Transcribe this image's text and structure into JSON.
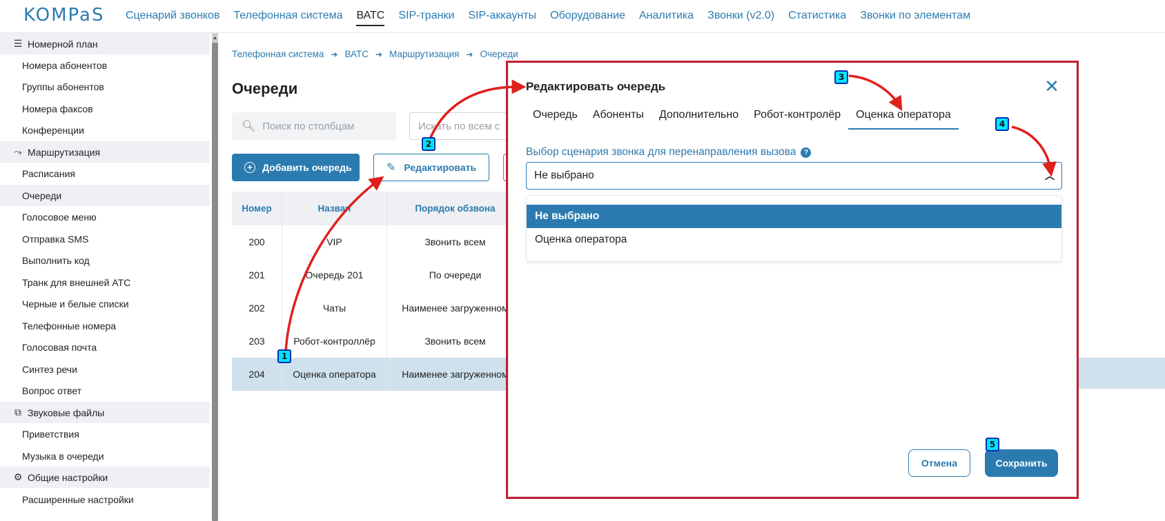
{
  "brand": {
    "logo_text": "KOMPaS",
    "accent": "#2b7bb0"
  },
  "nav": {
    "items": [
      "Сценарий звонков",
      "Телефонная система",
      "ВАТС",
      "SIP-транки",
      "SIP-аккаунты",
      "Оборудование",
      "Аналитика",
      "Звонки (v2.0)",
      "Статистика",
      "Звонки по элементам"
    ],
    "active_index": 2
  },
  "sidebar": {
    "groups": [
      {
        "icon": "list-icon",
        "label": "Номерной план",
        "items": [
          "Номера абонентов",
          "Группы абонентов",
          "Номера факсов",
          "Конференции"
        ]
      },
      {
        "icon": "routing-icon",
        "label": "Маршрутизация",
        "items": [
          "Расписания",
          "Очереди",
          "Голосовое меню",
          "Отправка SMS",
          "Выполнить код",
          "Транк для внешней АТС",
          "Черные и белые списки",
          "Телефонные номера",
          "Голосовая почта",
          "Синтез речи",
          "Вопрос ответ"
        ]
      },
      {
        "icon": "files-icon",
        "label": "Звуковые файлы",
        "items": [
          "Приветствия",
          "Музыка в очереди"
        ]
      },
      {
        "icon": "gear-icon",
        "label": "Общие настройки",
        "items": [
          "Расширенные настройки"
        ]
      }
    ],
    "selected_item": "Очереди"
  },
  "breadcrumb": [
    "Телефонная система",
    "ВАТС",
    "Маршрутизация",
    "Очереди"
  ],
  "page": {
    "title": "Очереди",
    "search_placeholder": "Поиск по столбцам",
    "search_all_placeholder": "Искать по всем с",
    "add_button": "Добавить очередь",
    "edit_button": "Редактировать"
  },
  "table": {
    "headers": [
      "Номер",
      "Назван",
      "Порядок обзвона"
    ],
    "rows": [
      [
        "200",
        "VIP",
        "Звонить всем"
      ],
      [
        "201",
        "Очередь 201",
        "По очереди"
      ],
      [
        "202",
        "Чаты",
        "Наименее загруженном"
      ],
      [
        "203",
        "Робот-контроллёр",
        "Звонить всем"
      ],
      [
        "204",
        "Оценка оператора",
        "Наименее загруженном"
      ]
    ],
    "selected_row": 4
  },
  "modal": {
    "title": "Редактировать очередь",
    "tabs": [
      "Очередь",
      "Абоненты",
      "Дополнительно",
      "Робот-контролёр",
      "Оценка оператора"
    ],
    "active_tab": 4,
    "field_label": "Выбор сценария звонка для перенаправления вызова",
    "help_glyph": "?",
    "select_value": "Не выбрано",
    "options": [
      "Не выбрано",
      "Оценка оператора"
    ],
    "cancel": "Отмена",
    "save": "Сохранить"
  },
  "markers": [
    "1",
    "2",
    "3",
    "4",
    "5"
  ]
}
